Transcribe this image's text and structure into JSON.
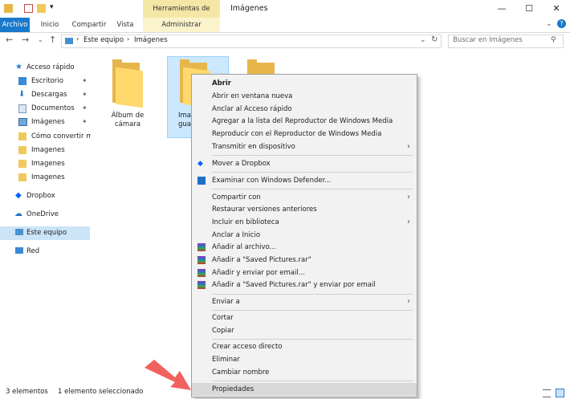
{
  "window": {
    "title": "Imágenes",
    "contextual_tab_group": "Herramientas de imagen",
    "controls": [
      "—",
      "☐",
      "✕"
    ]
  },
  "ribbon": {
    "tabs": [
      "Archivo",
      "Inicio",
      "Compartir",
      "Vista"
    ],
    "contextual_tab": "Administrar"
  },
  "address": {
    "path": [
      "Este equipo",
      "Imágenes"
    ],
    "search_placeholder": "Buscar en Imágenes"
  },
  "nav": {
    "quick_access": "Acceso rápido",
    "pinned": [
      "Escritorio",
      "Descargas",
      "Documentos",
      "Imágenes"
    ],
    "recent": [
      "Cómo convertir má",
      "Imagenes",
      "Imagenes",
      "Imagenes"
    ],
    "dropbox": "Dropbox",
    "onedrive": "OneDrive",
    "este_equipo": "Este equipo",
    "red": "Red"
  },
  "content": {
    "folder1_line1": "Álbum de",
    "folder1_line2": "cámara",
    "folder2_line1": "Ima",
    "folder2_line2": "gua"
  },
  "menu": {
    "abrir": "Abrir",
    "abrir_ventana": "Abrir en ventana nueva",
    "anclar_acceso": "Anclar al Acceso rápido",
    "agregar_lista": "Agregar a la lista del Reproductor de Windows Media",
    "reproducir": "Reproducir con el Reproductor de Windows Media",
    "transmitir": "Transmitir en dispositivo",
    "mover_dropbox": "Mover a Dropbox",
    "examinar": "Examinar con Windows Defender...",
    "compartir_con": "Compartir con",
    "restaurar": "Restaurar versiones anteriores",
    "incluir": "Incluir en biblioteca",
    "anclar_inicio": "Anclar a Inicio",
    "anadir_archivo": "Añadir al archivo...",
    "anadir_saved": "Añadir a \"Saved Pictures.rar\"",
    "anadir_email": "Añadir y enviar por email...",
    "anadir_saved_email": "Añadir a \"Saved Pictures.rar\" y enviar por email",
    "enviar_a": "Enviar a",
    "cortar": "Cortar",
    "copiar": "Copiar",
    "crear_acceso": "Crear acceso directo",
    "eliminar": "Eliminar",
    "cambiar_nombre": "Cambiar nombre",
    "propiedades": "Propiedades"
  },
  "status": {
    "count": "3 elementos",
    "selected": "1 elemento seleccionado"
  },
  "colors": {
    "accent": "#1979ca",
    "contextual_tab": "#f4e7a6",
    "selection": "#cce8ff",
    "annotation_arrow": "#f0625e"
  }
}
